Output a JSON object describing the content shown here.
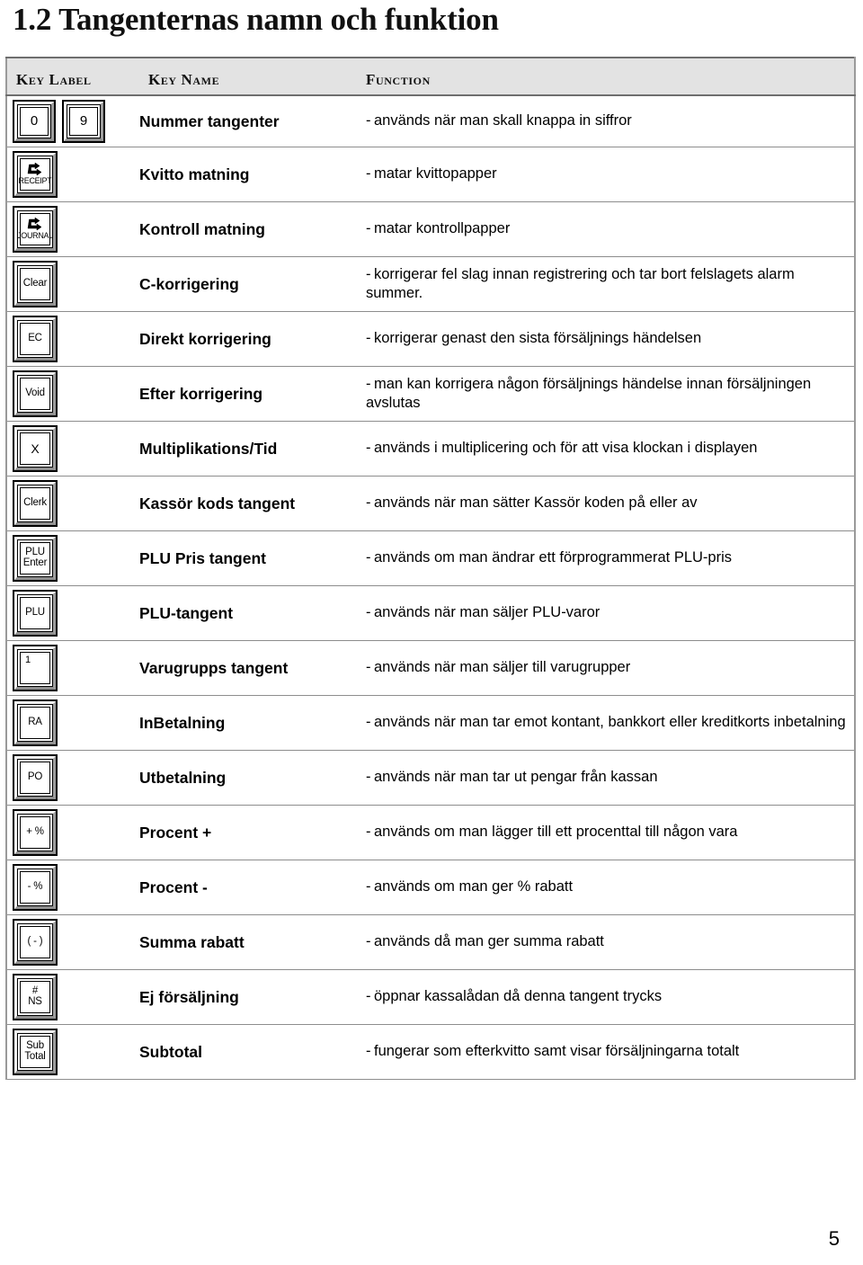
{
  "document": {
    "title": "1.2 Tangenternas namn och funktion",
    "page_number": "5"
  },
  "table": {
    "headers": {
      "key_label": "Key Label",
      "key_name": "Key Name",
      "function": "Function"
    },
    "rows": [
      {
        "keys": [
          {
            "type": "text",
            "cap": "0",
            "style": "num"
          },
          {
            "type": "text",
            "cap": "9",
            "style": "num"
          }
        ],
        "name": "Nummer tangenter",
        "function": "används när man skall knappa in siffror"
      },
      {
        "keys": [
          {
            "type": "feed",
            "cap": "RECEIPT",
            "style": "small"
          }
        ],
        "name": "Kvitto matning",
        "function": "matar kvittopapper"
      },
      {
        "keys": [
          {
            "type": "feed",
            "cap": "JOURNAL",
            "style": "small"
          }
        ],
        "name": "Kontroll matning",
        "function": "matar kontrollpapper"
      },
      {
        "keys": [
          {
            "type": "text",
            "cap": "Clear",
            "style": "normal"
          }
        ],
        "name": "C-korrigering",
        "function": "korrigerar fel slag innan registrering och tar bort felslagets alarm summer."
      },
      {
        "keys": [
          {
            "type": "text",
            "cap": "EC",
            "style": "normal"
          }
        ],
        "name": "Direkt korrigering",
        "function": "korrigerar genast den sista försäljnings händelsen"
      },
      {
        "keys": [
          {
            "type": "text",
            "cap": "Void",
            "style": "normal"
          }
        ],
        "name": "Efter korrigering",
        "function": "man kan korrigera någon försäljnings händelse innan försäljningen avslutas"
      },
      {
        "keys": [
          {
            "type": "text",
            "cap": "X",
            "style": "big"
          }
        ],
        "name": "Multiplikations/Tid",
        "function": "används i multiplicering och för att visa klockan i displayen"
      },
      {
        "keys": [
          {
            "type": "text",
            "cap": "Clerk",
            "style": "normal"
          }
        ],
        "name": "Kassör kods tangent",
        "function": "används när man sätter Kassör koden på eller av"
      },
      {
        "keys": [
          {
            "type": "stack",
            "cap": "PLU",
            "cap2": "Enter",
            "style": "normal"
          }
        ],
        "name": "PLU Pris tangent",
        "function": "används om man ändrar ett förprogrammerat PLU-pris"
      },
      {
        "keys": [
          {
            "type": "text",
            "cap": "PLU",
            "style": "normal"
          }
        ],
        "name": "PLU-tangent",
        "function": "används när man säljer PLU-varor"
      },
      {
        "keys": [
          {
            "type": "corner",
            "cap": "1",
            "style": "normal"
          }
        ],
        "name": "Varugrupps tangent",
        "function": "används när man säljer till varugrupper"
      },
      {
        "keys": [
          {
            "type": "text",
            "cap": "RA",
            "style": "normal"
          }
        ],
        "name": "InBetalning",
        "function": "används när man tar emot kontant, bankkort eller kreditkorts inbetalning"
      },
      {
        "keys": [
          {
            "type": "text",
            "cap": "PO",
            "style": "normal"
          }
        ],
        "name": "Utbetalning",
        "function": "används när man tar ut pengar från kassan"
      },
      {
        "keys": [
          {
            "type": "text",
            "cap": "+ %",
            "style": "normal"
          }
        ],
        "name": "Procent +",
        "function": "används om man lägger till ett procenttal till någon vara"
      },
      {
        "keys": [
          {
            "type": "text",
            "cap": "- %",
            "style": "normal"
          }
        ],
        "name": "Procent -",
        "function": "används om man ger % rabatt"
      },
      {
        "keys": [
          {
            "type": "text",
            "cap": "( - )",
            "style": "normal"
          }
        ],
        "name": "Summa rabatt",
        "function": "används då man ger summa rabatt"
      },
      {
        "keys": [
          {
            "type": "stack",
            "cap": "#",
            "cap2": "NS",
            "style": "normal"
          }
        ],
        "name": "Ej försäljning",
        "function": "öppnar kassalådan då denna tangent trycks"
      },
      {
        "keys": [
          {
            "type": "stack",
            "cap": "Sub",
            "cap2": "Total",
            "style": "normal"
          }
        ],
        "name": "Subtotal",
        "function": "fungerar som efterkvitto samt visar försäljningarna totalt"
      }
    ]
  },
  "icons": {
    "paper_feed": "paper-feed-arrow-icon"
  },
  "colors": {
    "header_background": "#e3e3e3",
    "border": "#6e6e6e",
    "row_divider": "#8d8d8d",
    "text": "#000000"
  }
}
